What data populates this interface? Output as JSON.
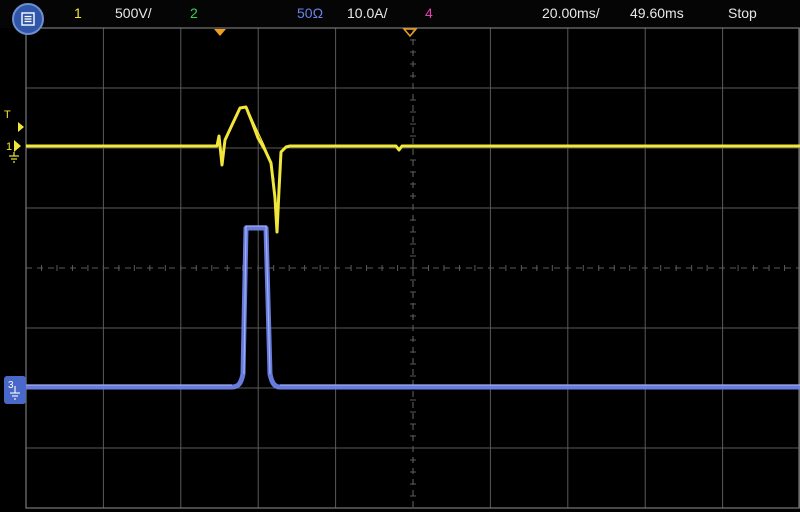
{
  "colors": {
    "ch1": "#f1e63a",
    "ch2": "#39d24c",
    "ch3": "#6b82e8",
    "ch4": "#e83fb0",
    "grid": "#5a5a5a",
    "text": "#e8e8e8",
    "trigger_marker": "#f0a020"
  },
  "toolbar": {
    "menu_icon": "list-icon",
    "ch1_label": "1",
    "ch1_scale": "500V/",
    "ch2_label": "2",
    "ch3_label": "50Ω",
    "ch3_scale": "10.0A/",
    "ch4_label": "4",
    "timebase": "20.00ms/",
    "delay": "49.60ms",
    "run_state": "Stop"
  },
  "screen": {
    "trigger_label": "T",
    "ch1_marker_label": "1",
    "ch3_marker_label": "3"
  }
}
